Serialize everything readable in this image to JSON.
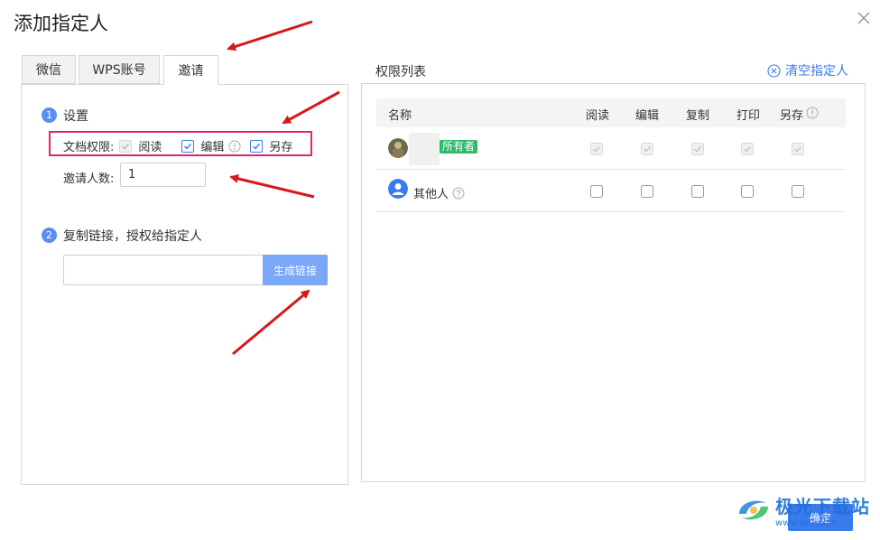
{
  "dialog": {
    "title": "添加指定人"
  },
  "tabs": [
    {
      "label": "微信",
      "active": false
    },
    {
      "label": "WPS账号",
      "active": false
    },
    {
      "label": "邀请",
      "active": true
    }
  ],
  "settings": {
    "step1_number": "1",
    "step1_label": "设置",
    "permission_label": "文档权限:",
    "permissions": [
      {
        "label": "阅读",
        "checked": true,
        "disabled": true
      },
      {
        "label": "编辑",
        "checked": true,
        "disabled": false,
        "has_info": true
      },
      {
        "label": "另存",
        "checked": true,
        "disabled": false
      }
    ],
    "invite_count_label": "邀请人数:",
    "invite_count_value": "1",
    "step2_number": "2",
    "step2_label": "复制链接，授权给指定人",
    "link_value": "",
    "generate_button": "生成链接"
  },
  "permission_list": {
    "title": "权限列表",
    "clear_label": "清空指定人",
    "columns": [
      "名称",
      "阅读",
      "编辑",
      "复制",
      "打印",
      "另存"
    ],
    "rows": [
      {
        "name": "",
        "badge": "所有者",
        "values": [
          true,
          true,
          true,
          true,
          true
        ],
        "disabled": true
      },
      {
        "name": "其他人",
        "values": [
          false,
          false,
          false,
          false,
          false
        ],
        "disabled": false
      }
    ]
  },
  "footer": {
    "confirm_label": "确定"
  },
  "watermark": {
    "main": "极光下载站",
    "sub": "www.xz7.com"
  },
  "colors": {
    "accent": "#3a7bec",
    "highlight_box": "#e0256e",
    "owner_badge": "#2dbb6a",
    "arrow": "#d6181d"
  }
}
